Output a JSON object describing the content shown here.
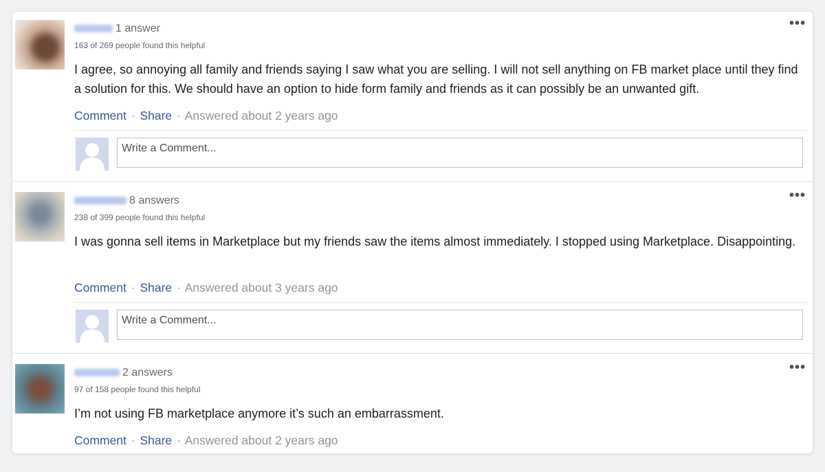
{
  "answers": [
    {
      "answer_count": "1 answer",
      "helpful": "163 of 269 people found this helpful",
      "text": "I agree, so annoying all family and friends saying I saw what you are selling. I will not sell anything on FB market place until they find a solution for this. We should have an option to hide form family and friends as it can possibly be an unwanted gift.",
      "comment_label": "Comment",
      "share_label": "Share",
      "answered": "Answered about 2 years ago",
      "comment_placeholder": "Write a Comment...",
      "more_label": "•••"
    },
    {
      "answer_count": "8 answers",
      "helpful": "238 of 399 people found this helpful",
      "text": "I was gonna sell items in Marketplace but my friends saw the items almost immediately. I stopped using Marketplace. Disappointing.",
      "comment_label": "Comment",
      "share_label": "Share",
      "answered": "Answered about 3 years ago",
      "comment_placeholder": "Write a Comment...",
      "more_label": "•••"
    },
    {
      "answer_count": "2 answers",
      "helpful": "97 of 158 people found this helpful",
      "text": "I’m not using FB marketplace anymore it’s such an embarrassment.",
      "comment_label": "Comment",
      "share_label": "Share",
      "answered": "Answered about 2 years ago",
      "more_label": "•••"
    }
  ],
  "separator": "·",
  "colors": {
    "link": "#385898",
    "meta": "#90949c",
    "avatar_placeholder": "#d1d9ec",
    "name_blur": "#b7c8ef"
  }
}
